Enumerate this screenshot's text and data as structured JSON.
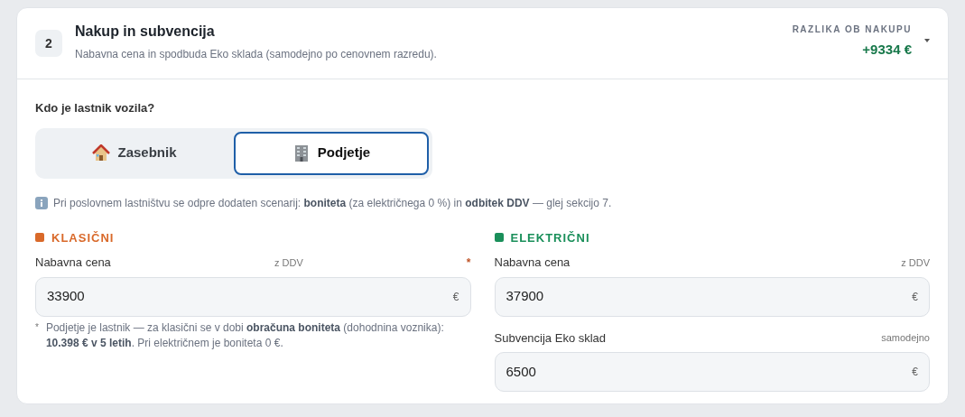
{
  "section": {
    "number": "2",
    "title": "Nakup in subvencija",
    "subtitle": "Nabavna cena in spodbuda Eko sklada (samodejno po cenovnem razredu).",
    "summary_label": "RAZLIKA OB NAKUPU",
    "summary_value": "+9334 €",
    "expanded": true
  },
  "owner": {
    "question": "Kdo je lastnik vozila?",
    "options": [
      {
        "label": "Zasebnik",
        "kind": "house",
        "selected": false
      },
      {
        "label": "Podjetje",
        "kind": "building",
        "selected": true
      }
    ],
    "info": "Pri poslovnem lastništvu se odpre dodaten scenarij: **boniteta** (za električnega 0 %) in **odbitek DDV** — glej sekcijo 7."
  },
  "columns": [
    {
      "title": "KLASIČNI",
      "color": "#d9692a",
      "fields": [
        {
          "label": "Nabavna cena",
          "hint": "z DDV",
          "required_mark": "*",
          "value": "33900",
          "unit": "€"
        }
      ],
      "note_mark": "*",
      "note": "Podjetje je lastnik — za klasični se v dobi **obračuna boniteta** (dohodnina voznika): **10.398 € v 5 letih**. Pri električnem je boniteta 0 €."
    },
    {
      "title": "ELEKTRIČNI",
      "color": "#1a8f5a",
      "fields": [
        {
          "label": "Nabavna cena",
          "hint": "z DDV",
          "value": "37900",
          "unit": "€"
        },
        {
          "label": "Subvencija Eko sklad",
          "hint": "samodejno",
          "value": "6500",
          "unit": "€"
        }
      ]
    }
  ]
}
